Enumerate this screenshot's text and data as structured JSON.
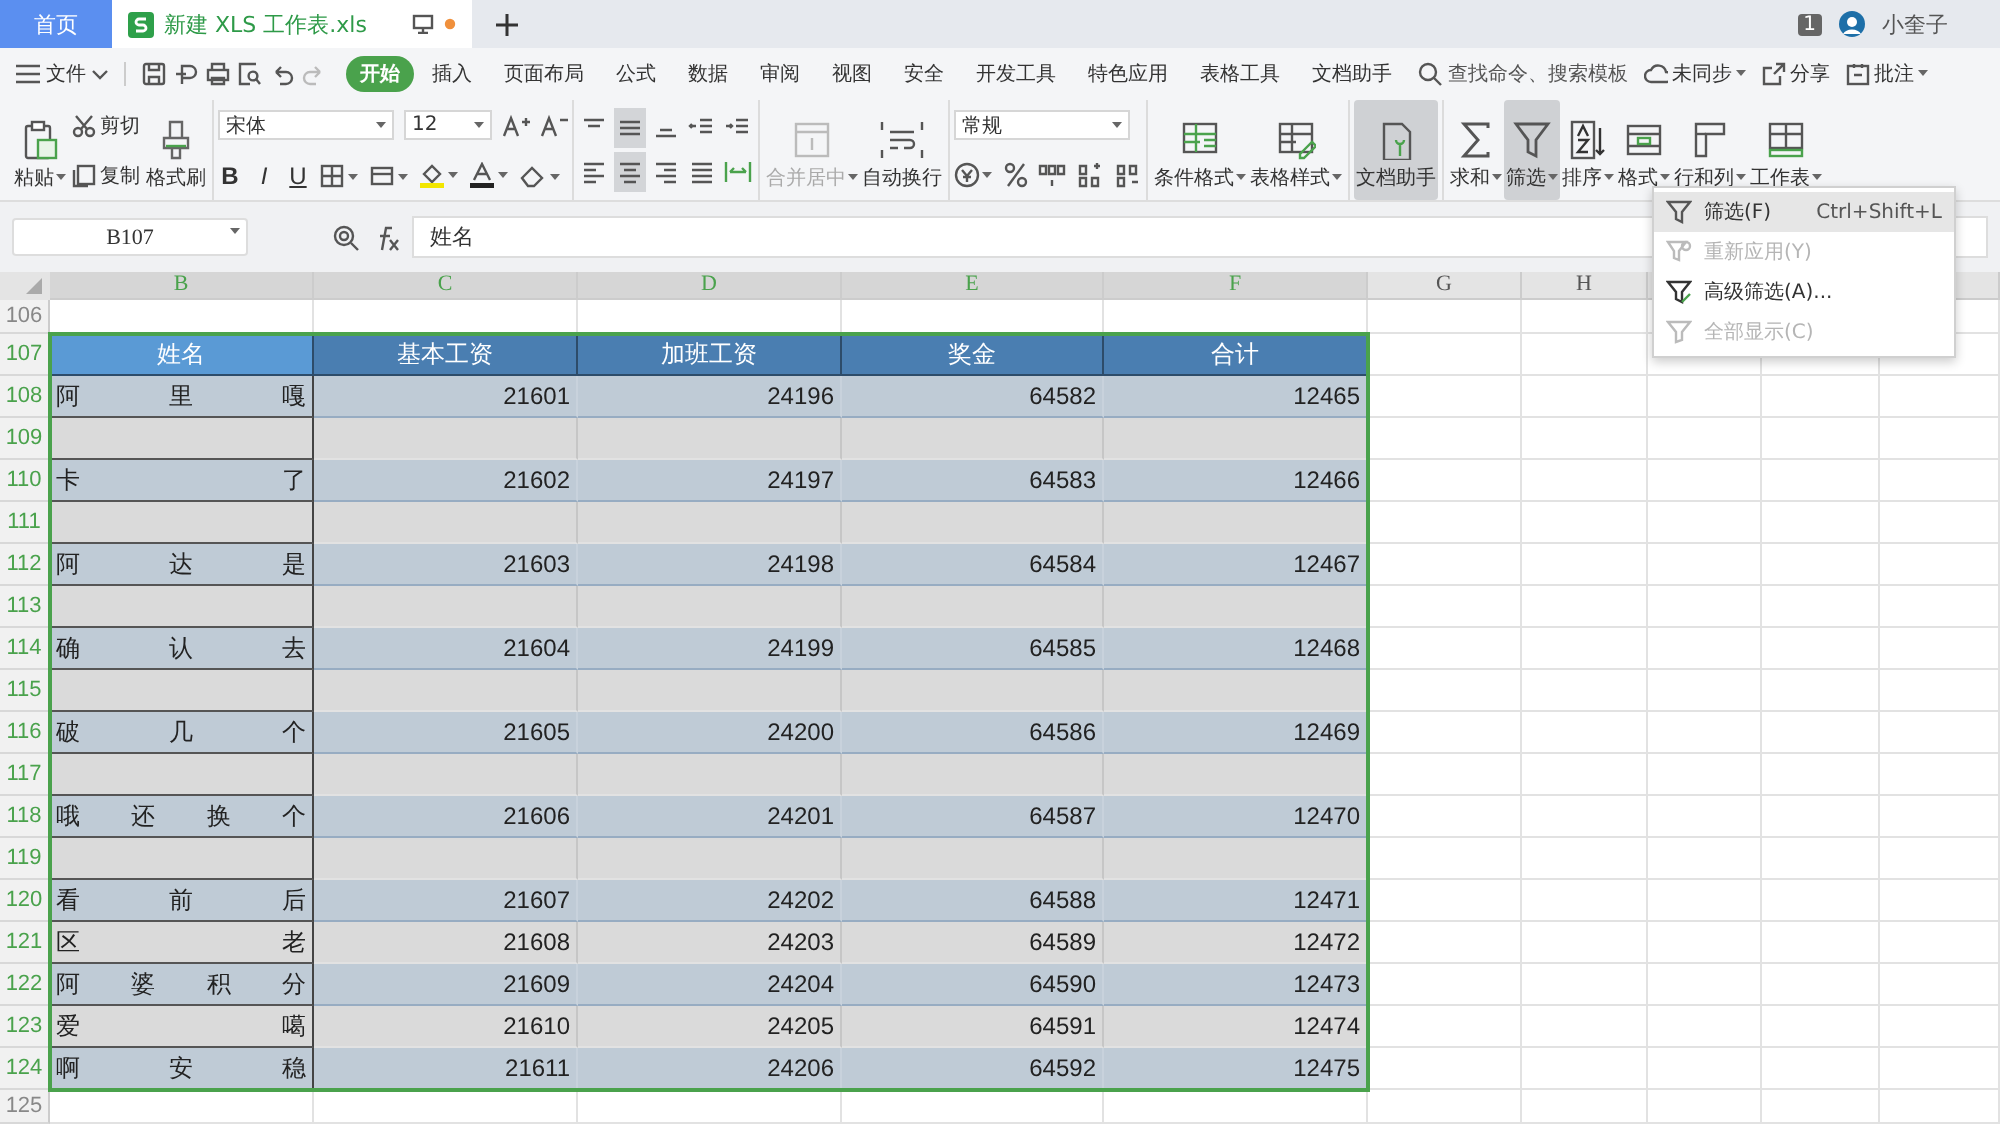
{
  "tabs": [
    {
      "label": "首页",
      "selected": false,
      "kind": "home"
    },
    {
      "label": "新建 XLS 工作表.xls",
      "selected": true,
      "kind": "file",
      "modified": true
    }
  ],
  "account": {
    "badge": "1",
    "user": "小奎子"
  },
  "menu": {
    "file": "文件",
    "items": [
      {
        "label": "开始",
        "selected": true
      },
      {
        "label": "插入",
        "selected": false
      },
      {
        "label": "页面布局",
        "selected": false
      },
      {
        "label": "公式",
        "selected": false
      },
      {
        "label": "数据",
        "selected": false
      },
      {
        "label": "审阅",
        "selected": false
      },
      {
        "label": "视图",
        "selected": false
      },
      {
        "label": "安全",
        "selected": false
      },
      {
        "label": "开发工具",
        "selected": false
      },
      {
        "label": "特色应用",
        "selected": false
      },
      {
        "label": "表格工具",
        "selected": false
      },
      {
        "label": "文档助手",
        "selected": false
      }
    ],
    "search": {
      "placeholder": "查找命令、搜索模板"
    },
    "right": [
      "未同步",
      "分享",
      "批注"
    ]
  },
  "ribbon": {
    "paste": "粘贴",
    "cut": "剪切",
    "copy": "复制",
    "format_painter": "格式刷",
    "font": "宋体",
    "font_size": "12",
    "bold": "B",
    "italic": "I",
    "underline": "U",
    "merge": {
      "label": "合并居中",
      "disabled": true
    },
    "wrap": "自动换行",
    "number_format": "常规",
    "tools": [
      {
        "label": "条件格式",
        "kind": "condformat",
        "pressed": false
      },
      {
        "label": "表格样式",
        "kind": "tablestyle",
        "pressed": false
      },
      {
        "label": "文档助手",
        "kind": "assistant",
        "pressed": true
      },
      {
        "label": "求和",
        "kind": "sum",
        "pressed": false
      },
      {
        "label": "筛选",
        "kind": "filter",
        "pressed": true
      },
      {
        "label": "排序",
        "kind": "sort",
        "pressed": false
      },
      {
        "label": "格式",
        "kind": "format",
        "pressed": false
      },
      {
        "label": "行和列",
        "kind": "rowcol",
        "pressed": false
      },
      {
        "label": "工作表",
        "kind": "sheet",
        "pressed": false
      }
    ]
  },
  "formula_bar": {
    "name_box": "B107",
    "value": "姓名"
  },
  "sheet": {
    "columns": [
      {
        "label": "B",
        "selected": true
      },
      {
        "label": "C",
        "selected": true
      },
      {
        "label": "D",
        "selected": true
      },
      {
        "label": "E",
        "selected": true
      },
      {
        "label": "F",
        "selected": true
      },
      {
        "label": "G",
        "selected": false
      },
      {
        "label": "H",
        "selected": false
      }
    ],
    "rows": [
      {
        "number": "106",
        "kind": "plain",
        "selected": false
      },
      {
        "number": "107",
        "kind": "header",
        "selected": true,
        "cells": [
          {
            "text": "姓名",
            "selected": true
          },
          {
            "text": "基本工资",
            "selected": false
          },
          {
            "text": "加班工资",
            "selected": false
          },
          {
            "text": "奖金",
            "selected": false
          },
          {
            "text": "合计",
            "selected": false
          }
        ]
      },
      {
        "number": "108",
        "kind": "data",
        "selected": true,
        "highlighted": true,
        "cells": [
          "阿 里 嘎",
          "21601",
          "24196",
          "64582",
          "12465"
        ]
      },
      {
        "number": "109",
        "kind": "blank",
        "selected": true
      },
      {
        "number": "110",
        "kind": "data",
        "selected": true,
        "highlighted": true,
        "cells": [
          "卡 了",
          "21602",
          "24197",
          "64583",
          "12466"
        ]
      },
      {
        "number": "111",
        "kind": "blank",
        "selected": true
      },
      {
        "number": "112",
        "kind": "data",
        "selected": true,
        "highlighted": true,
        "cells": [
          "阿 达 是",
          "21603",
          "24198",
          "64584",
          "12467"
        ]
      },
      {
        "number": "113",
        "kind": "blank",
        "selected": true
      },
      {
        "number": "114",
        "kind": "data",
        "selected": true,
        "highlighted": true,
        "cells": [
          "确 认 去",
          "21604",
          "24199",
          "64585",
          "12468"
        ]
      },
      {
        "number": "115",
        "kind": "blank",
        "selected": true
      },
      {
        "number": "116",
        "kind": "data",
        "selected": true,
        "highlighted": true,
        "cells": [
          "破 几 个",
          "21605",
          "24200",
          "64586",
          "12469"
        ]
      },
      {
        "number": "117",
        "kind": "blank",
        "selected": true
      },
      {
        "number": "118",
        "kind": "data",
        "selected": true,
        "highlighted": true,
        "cells": [
          "哦 还 换 个",
          "21606",
          "24201",
          "64587",
          "12470"
        ]
      },
      {
        "number": "119",
        "kind": "blank",
        "selected": true
      },
      {
        "number": "120",
        "kind": "data",
        "selected": true,
        "highlighted": true,
        "cells": [
          "看 前 后",
          "21607",
          "24202",
          "64588",
          "12471"
        ]
      },
      {
        "number": "121",
        "kind": "data",
        "selected": true,
        "highlighted": false,
        "cells": [
          "区 老",
          "21608",
          "24203",
          "64589",
          "12472"
        ]
      },
      {
        "number": "122",
        "kind": "data",
        "selected": true,
        "highlighted": true,
        "cells": [
          "阿 婆 积 分",
          "21609",
          "24204",
          "64590",
          "12473"
        ]
      },
      {
        "number": "123",
        "kind": "data",
        "selected": true,
        "highlighted": false,
        "cells": [
          "爱 噶",
          "21610",
          "24205",
          "64591",
          "12474"
        ]
      },
      {
        "number": "124",
        "kind": "data",
        "selected": true,
        "highlighted": true,
        "cells": [
          "啊 安 稳",
          "21611",
          "24206",
          "64592",
          "12475"
        ]
      },
      {
        "number": "125",
        "kind": "plain",
        "selected": false
      }
    ]
  },
  "filter_menu": [
    {
      "label": "筛选(F)",
      "shortcut": "Ctrl+Shift+L",
      "highlighted": true,
      "disabled": false,
      "kind": "filter"
    },
    {
      "label": "重新应用(Y)",
      "highlighted": false,
      "disabled": true,
      "kind": "reapply"
    },
    {
      "label": "高级筛选(A)...",
      "highlighted": false,
      "disabled": false,
      "kind": "advanced"
    },
    {
      "label": "全部显示(C)",
      "highlighted": false,
      "disabled": true,
      "kind": "showall"
    }
  ]
}
